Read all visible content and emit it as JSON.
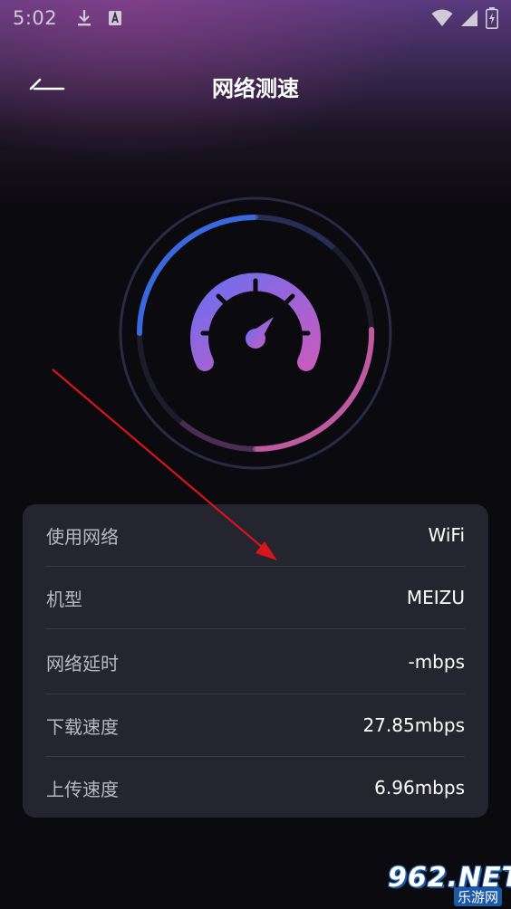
{
  "status_bar": {
    "time": "5:02",
    "icons": [
      "download-icon",
      "a-badge-icon",
      "wifi-icon",
      "signal-icon",
      "battery-charging-icon"
    ]
  },
  "header": {
    "back_icon": "back-arrow-icon",
    "title": "网络测速"
  },
  "gauge": {
    "icon": "speedometer-icon",
    "colors": {
      "start": "#3a6ee8",
      "end": "#d05aa8",
      "ring": "#2a2a44"
    }
  },
  "info": {
    "rows": [
      {
        "label": "使用网络",
        "value": "WiFi"
      },
      {
        "label": "机型",
        "value": "MEIZU"
      },
      {
        "label": "网络延时",
        "value": "-mbps"
      },
      {
        "label": "下载速度",
        "value": "27.85mbps"
      },
      {
        "label": "上传速度",
        "value": "6.96mbps"
      }
    ]
  },
  "watermark": {
    "main": "962.NET",
    "sub": "乐游网"
  }
}
